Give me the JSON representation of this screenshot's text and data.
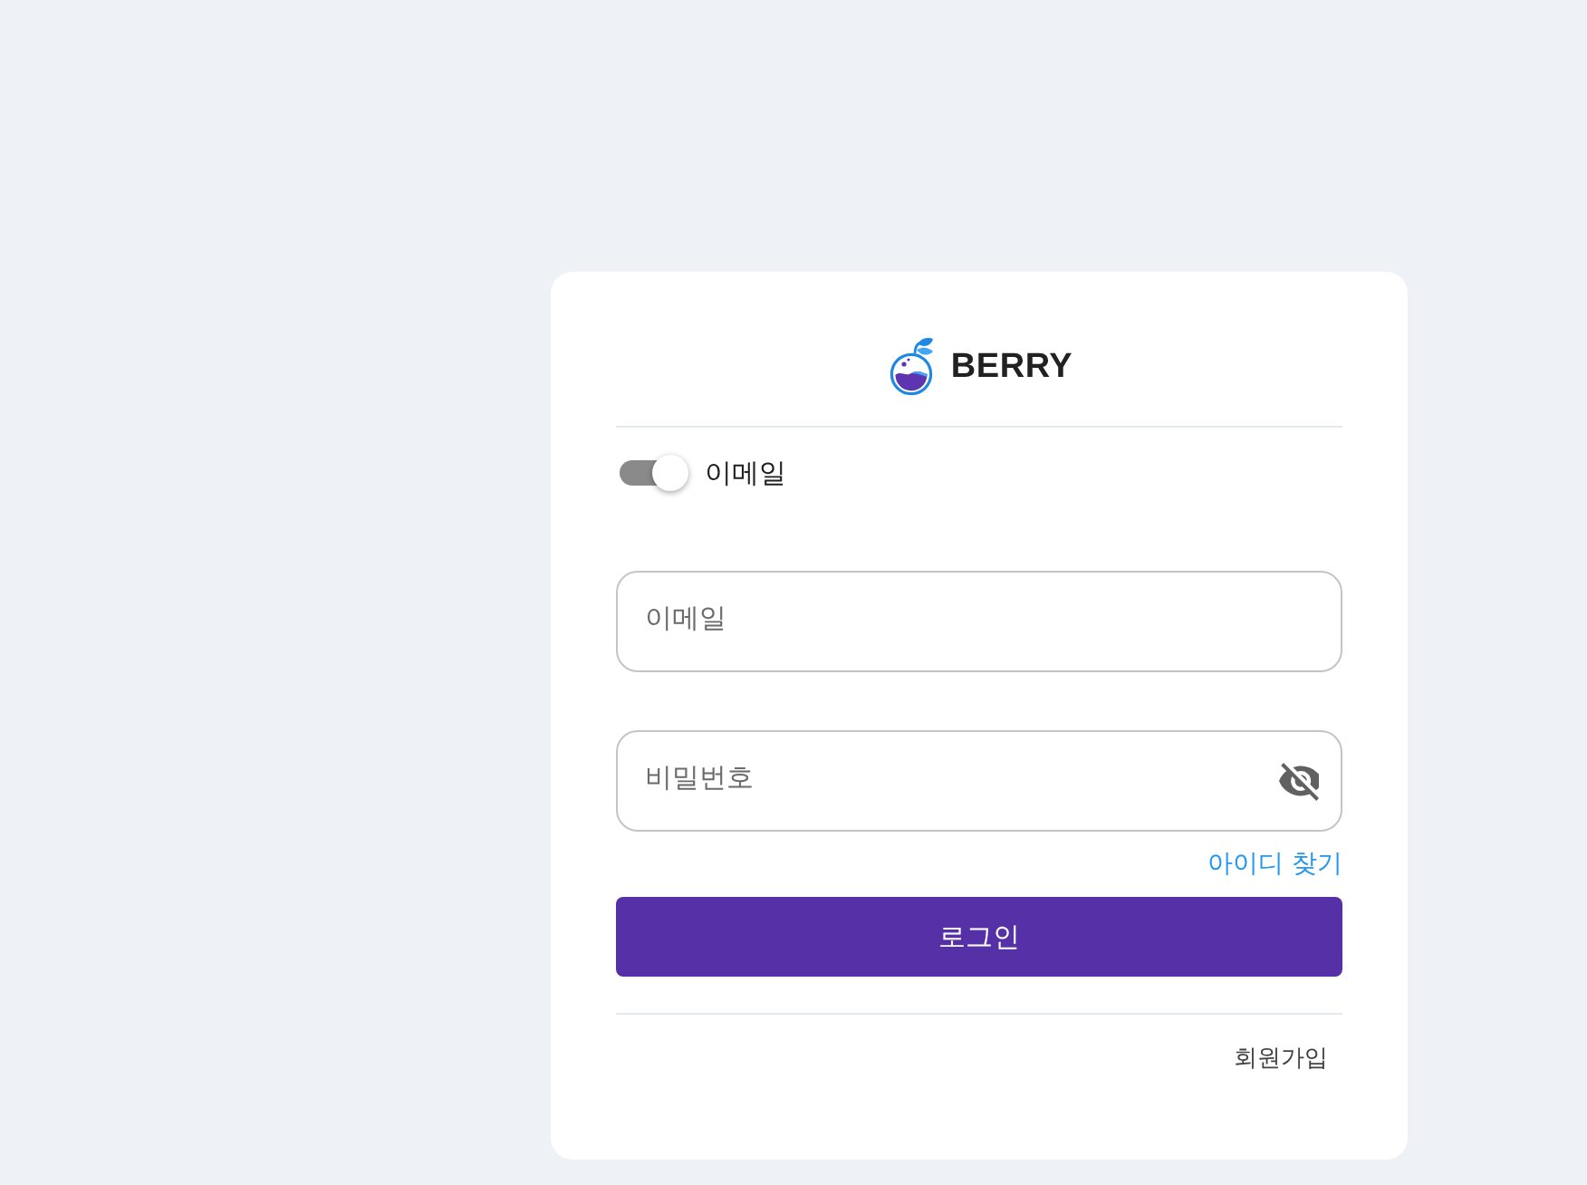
{
  "logo": {
    "text": "BERRY"
  },
  "login_mode": {
    "label": "이메일",
    "on": true
  },
  "fields": [
    {
      "kind": "text",
      "placeholder": "이메일"
    },
    {
      "kind": "password",
      "placeholder": "비밀번호"
    }
  ],
  "find_id_link": "아이디 찾기",
  "login_button": "로그인",
  "signup_button": "회원가입"
}
